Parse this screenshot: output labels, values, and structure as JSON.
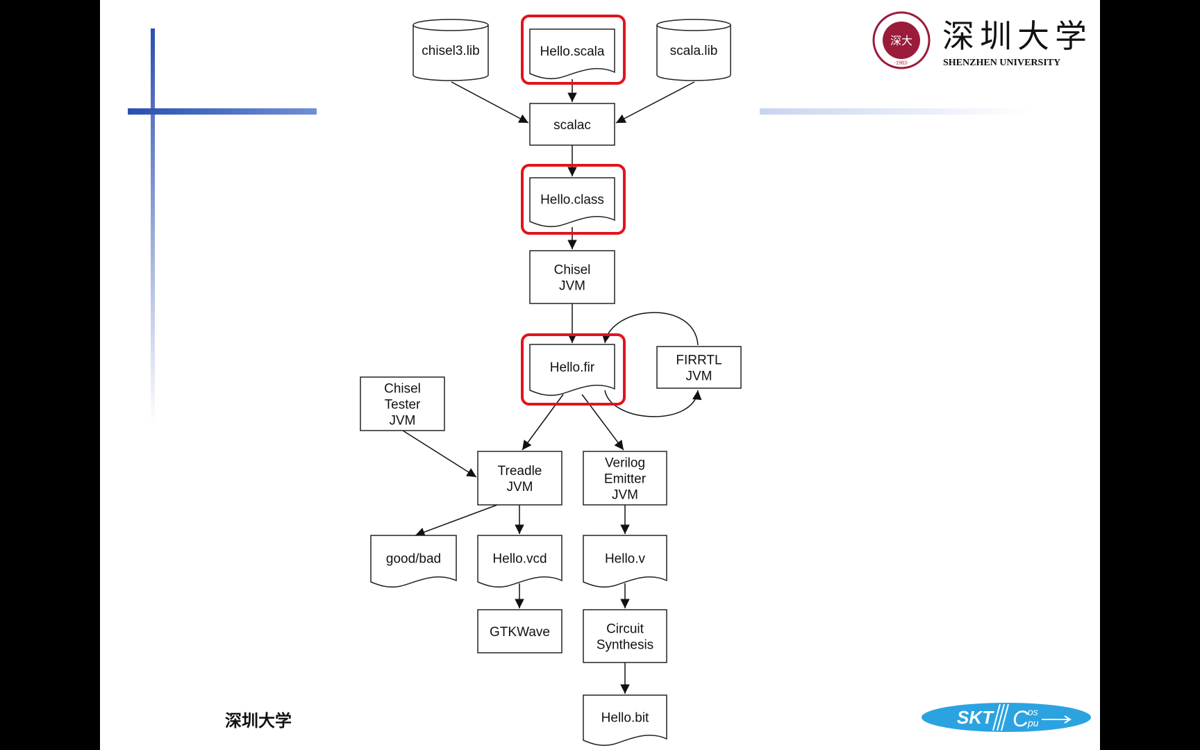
{
  "header": {
    "logo_cn": "深圳大学",
    "logo_en": "SHENZHEN UNIVERSITY",
    "seal_text": "SHENZHEN UNIVERSITY 1983"
  },
  "footer": {
    "text": "深圳大学",
    "logo_left": "SKT",
    "logo_right": "Cos pu"
  },
  "colors": {
    "highlight": "#e0141e",
    "accent_bar": "#2b4fb0",
    "logo_blue": "#2ba3e0",
    "seal": "#9b1b3a"
  },
  "nodes": {
    "chisel3_lib": {
      "lines": [
        "chisel3.lib"
      ],
      "shape": "cylinder"
    },
    "hello_scala": {
      "lines": [
        "Hello.scala"
      ],
      "shape": "document",
      "highlighted": true
    },
    "scala_lib": {
      "lines": [
        "scala.lib"
      ],
      "shape": "cylinder"
    },
    "scalac": {
      "lines": [
        "scalac"
      ],
      "shape": "box"
    },
    "hello_class": {
      "lines": [
        "Hello.class"
      ],
      "shape": "document",
      "highlighted": true
    },
    "chisel_jvm": {
      "lines": [
        "Chisel",
        "JVM"
      ],
      "shape": "box"
    },
    "hello_fir": {
      "lines": [
        "Hello.fir"
      ],
      "shape": "document",
      "highlighted": true
    },
    "firrtl_jvm": {
      "lines": [
        "FIRRTL",
        "JVM"
      ],
      "shape": "box"
    },
    "chisel_tester_jvm": {
      "lines": [
        "Chisel",
        "Tester",
        "JVM"
      ],
      "shape": "box"
    },
    "treadle_jvm": {
      "lines": [
        "Treadle",
        "JVM"
      ],
      "shape": "box"
    },
    "verilog_emitter_jvm": {
      "lines": [
        "Verilog",
        "Emitter",
        "JVM"
      ],
      "shape": "box"
    },
    "good_bad": {
      "lines": [
        "good/bad"
      ],
      "shape": "document"
    },
    "hello_vcd": {
      "lines": [
        "Hello.vcd"
      ],
      "shape": "document"
    },
    "hello_v": {
      "lines": [
        "Hello.v"
      ],
      "shape": "document"
    },
    "gtkwave": {
      "lines": [
        "GTKWave"
      ],
      "shape": "box"
    },
    "circuit_synthesis": {
      "lines": [
        "Circuit",
        "Synthesis"
      ],
      "shape": "box"
    },
    "hello_bit": {
      "lines": [
        "Hello.bit"
      ],
      "shape": "document"
    }
  },
  "edges": [
    [
      "chisel3_lib",
      "scalac"
    ],
    [
      "scala_lib",
      "scalac"
    ],
    [
      "hello_scala",
      "scalac"
    ],
    [
      "scalac",
      "hello_class"
    ],
    [
      "hello_class",
      "chisel_jvm"
    ],
    [
      "chisel_jvm",
      "hello_fir"
    ],
    [
      "hello_fir",
      "firrtl_jvm"
    ],
    [
      "firrtl_jvm",
      "hello_fir"
    ],
    [
      "hello_fir",
      "treadle_jvm"
    ],
    [
      "hello_fir",
      "verilog_emitter_jvm"
    ],
    [
      "chisel_tester_jvm",
      "treadle_jvm"
    ],
    [
      "treadle_jvm",
      "good_bad"
    ],
    [
      "treadle_jvm",
      "hello_vcd"
    ],
    [
      "verilog_emitter_jvm",
      "hello_v"
    ],
    [
      "hello_vcd",
      "gtkwave"
    ],
    [
      "hello_v",
      "circuit_synthesis"
    ],
    [
      "circuit_synthesis",
      "hello_bit"
    ]
  ]
}
